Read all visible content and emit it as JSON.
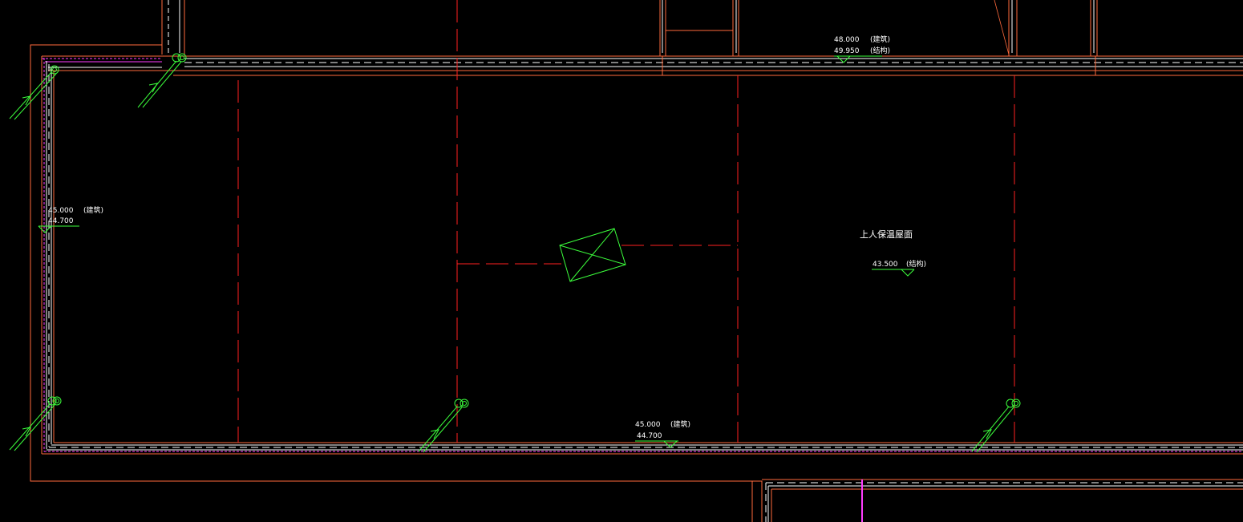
{
  "drawing": {
    "colors": {
      "background": "#000000",
      "wall": "#ff6a3d",
      "axis": "#ff2020",
      "insulation": "#ffffff",
      "waterproof": "#ff3cff",
      "annotation": "#3cff3c",
      "text": "#ffffff"
    },
    "room_label": "上人保温屋面",
    "elevations": {
      "top_right": {
        "finish": "48.000",
        "finish_note": "(建筑)",
        "structure": "49.950",
        "structure_note": "(结构)"
      },
      "left_wall": {
        "finish": "45.000",
        "finish_note": "(建筑)",
        "structure": "44.700"
      },
      "bottom_wall": {
        "finish": "45.000",
        "finish_note": "(建筑)",
        "structure": "44.700"
      },
      "roof": {
        "value": "43.500",
        "note": "(结构)"
      }
    },
    "symbols": {
      "drains": [
        "roof-drain-top-left",
        "roof-drain-left-top",
        "roof-drain-left-bottom",
        "roof-drain-bottom-middle",
        "roof-drain-bottom-right"
      ],
      "skylight": "skylight-box-icon"
    }
  }
}
